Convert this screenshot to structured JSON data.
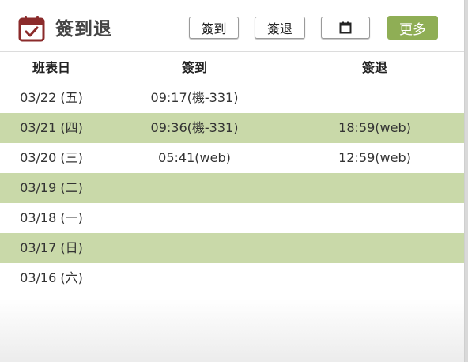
{
  "header": {
    "title": "簽到退",
    "checkin_label": "簽到",
    "checkout_label": "簽退",
    "more_label": "更多",
    "icon": "calendar-check-icon",
    "accent_color": "#8fae55",
    "title_icon_color": "#8b2b2b"
  },
  "table": {
    "columns": [
      "班表日",
      "簽到",
      "簽退"
    ],
    "stripe_color": "#c9d9a9",
    "rows": [
      {
        "date": "03/22 (五)",
        "in": "09:17(機-331)",
        "out": ""
      },
      {
        "date": "03/21 (四)",
        "in": "09:36(機-331)",
        "out": "18:59(web)"
      },
      {
        "date": "03/20 (三)",
        "in": "05:41(web)",
        "out": "12:59(web)"
      },
      {
        "date": "03/19 (二)",
        "in": "",
        "out": ""
      },
      {
        "date": "03/18 (一)",
        "in": "",
        "out": ""
      },
      {
        "date": "03/17 (日)",
        "in": "",
        "out": ""
      },
      {
        "date": "03/16 (六)",
        "in": "",
        "out": ""
      }
    ]
  }
}
